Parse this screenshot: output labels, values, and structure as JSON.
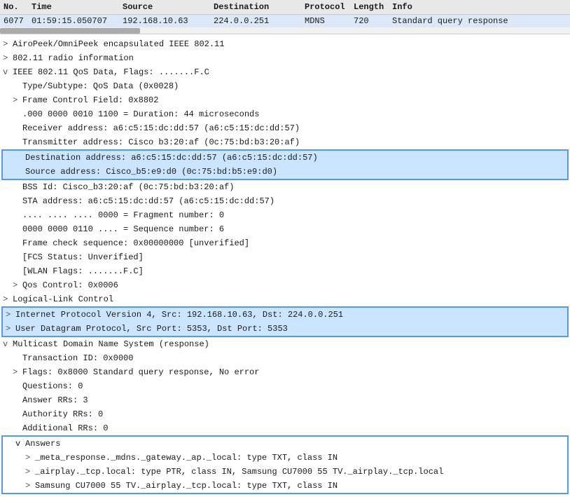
{
  "header": {
    "cols": {
      "no": "No.",
      "time": "Time",
      "source": "Source",
      "destination": "Destination",
      "protocol": "Protocol",
      "length": "Length",
      "info": "Info"
    }
  },
  "packet": {
    "no": "6077",
    "time": "01:59:15.050707",
    "source": "192.168.10.63",
    "destination": "224.0.0.251",
    "protocol": "MDNS",
    "length": "720",
    "info": "Standard query response"
  },
  "tree": {
    "items": [
      {
        "id": "airopeel",
        "indent": 0,
        "expand": ">",
        "text": "AiroPeek/OmniPeek encapsulated IEEE 802.11",
        "highlight": false
      },
      {
        "id": "radio",
        "indent": 0,
        "expand": ">",
        "text": "802.11 radio information",
        "highlight": false
      },
      {
        "id": "ieee",
        "indent": 0,
        "expand": "v",
        "text": "IEEE 802.11 QoS Data, Flags: .......F.C",
        "highlight": false
      },
      {
        "id": "type",
        "indent": 1,
        "expand": "",
        "text": "Type/Subtype: QoS Data (0x0028)",
        "highlight": false
      },
      {
        "id": "frame",
        "indent": 1,
        "expand": ">",
        "text": "Frame Control Field: 0x8802",
        "highlight": false
      },
      {
        "id": "duration",
        "indent": 1,
        "expand": "",
        "text": ".000 0000 0010 1100 = Duration: 44 microseconds",
        "highlight": false
      },
      {
        "id": "receiver",
        "indent": 1,
        "expand": "",
        "text": "Receiver address: a6:c5:15:dc:dd:57 (a6:c5:15:dc:dd:57)",
        "highlight": false
      },
      {
        "id": "transmitter",
        "indent": 1,
        "expand": "",
        "text": "Transmitter address: Cisco b3:20:af (0c:75:bd:b3:20:af)",
        "highlight": false
      },
      {
        "id": "dest-addr",
        "indent": 1,
        "expand": "",
        "text": "Destination address: a6:c5:15:dc:dd:57 (a6:c5:15:dc:dd:57)",
        "highlight": true,
        "boxStart": true
      },
      {
        "id": "src-addr",
        "indent": 1,
        "expand": "",
        "text": "Source address: Cisco_b5:e9:d0 (0c:75:bd:b5:e9:d0)",
        "highlight": true,
        "boxEnd": true
      },
      {
        "id": "bss",
        "indent": 1,
        "expand": "",
        "text": "BSS Id: Cisco_b3:20:af (0c:75:bd:b3:20:af)",
        "highlight": false
      },
      {
        "id": "sta",
        "indent": 1,
        "expand": "",
        "text": "STA address: a6:c5:15:dc:dd:57 (a6:c5:15:dc:dd:57)",
        "highlight": false
      },
      {
        "id": "fragment",
        "indent": 1,
        "expand": "",
        "text": ".... .... .... 0000 = Fragment number: 0",
        "highlight": false
      },
      {
        "id": "sequence",
        "indent": 1,
        "expand": "",
        "text": "0000 0000 0110 .... = Sequence number: 6",
        "highlight": false
      },
      {
        "id": "fcs-val",
        "indent": 1,
        "expand": "",
        "text": "Frame check sequence: 0x00000000 [unverified]",
        "highlight": false
      },
      {
        "id": "fcs-status",
        "indent": 1,
        "expand": "",
        "text": "[FCS Status: Unverified]",
        "highlight": false
      },
      {
        "id": "wlan-flags",
        "indent": 1,
        "expand": "",
        "text": "[WLAN Flags: .......F.C]",
        "highlight": false
      },
      {
        "id": "qos",
        "indent": 1,
        "expand": ">",
        "text": "Qos Control: 0x0006",
        "highlight": false
      },
      {
        "id": "llc",
        "indent": 0,
        "expand": ">",
        "text": "Logical-Link Control",
        "highlight": false
      },
      {
        "id": "ip",
        "indent": 0,
        "expand": ">",
        "text": "Internet Protocol Version 4, Src: 192.168.10.63, Dst: 224.0.0.251",
        "highlight": true,
        "boxStart": true
      },
      {
        "id": "udp",
        "indent": 0,
        "expand": ">",
        "text": "User Datagram Protocol, Src Port: 5353, Dst Port: 5353",
        "highlight": true,
        "boxEnd": true
      },
      {
        "id": "mdns",
        "indent": 0,
        "expand": "v",
        "text": "Multicast Domain Name System (response)",
        "highlight": false
      },
      {
        "id": "txid",
        "indent": 1,
        "expand": "",
        "text": "Transaction ID: 0x0000",
        "highlight": false
      },
      {
        "id": "flags2",
        "indent": 1,
        "expand": ">",
        "text": "Flags: 0x8000 Standard query response, No error",
        "highlight": false
      },
      {
        "id": "questions",
        "indent": 1,
        "expand": "",
        "text": "Questions: 0",
        "highlight": false
      },
      {
        "id": "answer-rrs",
        "indent": 1,
        "expand": "",
        "text": "Answer RRs: 3",
        "highlight": false
      },
      {
        "id": "auth-rrs",
        "indent": 1,
        "expand": "",
        "text": "Authority RRs: 0",
        "highlight": false
      },
      {
        "id": "addl-rrs",
        "indent": 1,
        "expand": "",
        "text": "Additional RRs: 0",
        "highlight": false
      }
    ],
    "answers": {
      "label": "Answers",
      "items": [
        {
          "id": "ans1",
          "expand": ">",
          "text": "_meta_response._mdns._gateway._ap._local: type TXT, class IN"
        },
        {
          "id": "ans2",
          "expand": ">",
          "text": "_airplay._tcp.local: type PTR, class IN, Samsung CU7000 55 TV._airplay._tcp.local"
        },
        {
          "id": "ans3",
          "expand": ">",
          "text": "Samsung CU7000 55 TV._airplay._tcp.local: type TXT, class IN"
        }
      ]
    }
  }
}
